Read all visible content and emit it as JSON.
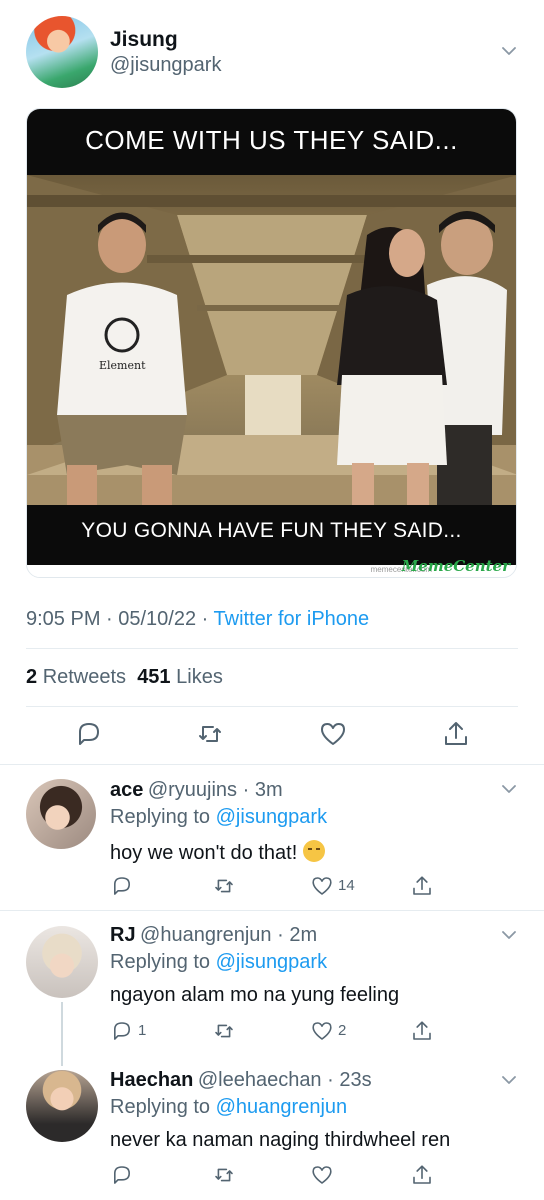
{
  "tweet": {
    "name": "Jisung",
    "handle": "@jisungpark",
    "meme_top": "COME WITH US THEY SAID...",
    "meme_bottom": "YOU GONNA HAVE FUN THEY SAID...",
    "meme_wm_small": "memecenter.com",
    "meme_wm_logo": "MemeCenter",
    "shirt_text": "Element",
    "time": "9:05 PM · 05/10/22 · ",
    "source": "Twitter for iPhone",
    "retweets_count": "2",
    "retweets_label": "Retweets",
    "likes_count": "451",
    "likes_label": "Likes"
  },
  "replies": [
    {
      "name": "ace",
      "handle": "@ryuujins · 3m",
      "replying_prefix": "Replying to ",
      "replying_to": "@jisungpark",
      "text": "hoy we won't do that!",
      "emoji": "grimacing-face-emoji",
      "reply_count": "",
      "like_count": "14"
    },
    {
      "name": "RJ",
      "handle": "@huangrenjun · 2m",
      "replying_prefix": "Replying to ",
      "replying_to": "@jisungpark",
      "text": "ngayon alam mo na yung feeling",
      "reply_count": "1",
      "like_count": "2"
    },
    {
      "name": "Haechan",
      "handle": "@leehaechan · 23s",
      "replying_prefix": "Replying to ",
      "replying_to": "@huangrenjun",
      "text": "never ka naman naging thirdwheel ren",
      "reply_count": "",
      "like_count": ""
    }
  ],
  "colors": {
    "accent": "#1d9bf0",
    "secondary_text": "#536471",
    "primary_text": "#0f1419",
    "divider": "#e6ecf0"
  },
  "icons": [
    "chevron-down-icon",
    "reply-icon",
    "retweet-icon",
    "like-icon",
    "share-icon"
  ]
}
